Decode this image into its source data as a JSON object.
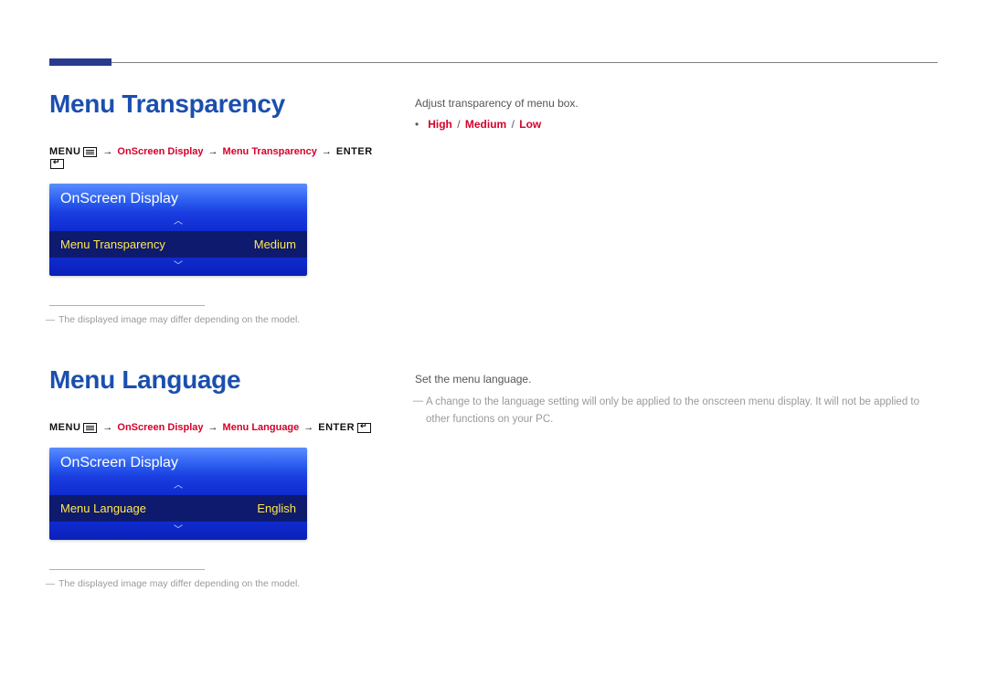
{
  "section1": {
    "heading": "Menu Transparency",
    "breadcrumb": {
      "menu": "MENU",
      "part1": "OnScreen Display",
      "part2": "Menu Transparency",
      "enter": "ENTER"
    },
    "osd": {
      "title": "OnScreen Display",
      "item_label": "Menu Transparency",
      "item_value": "Medium"
    },
    "footnote": "The displayed image may differ depending on the model.",
    "right": {
      "intro": "Adjust transparency of menu box.",
      "options": [
        "High",
        "Medium",
        "Low"
      ]
    }
  },
  "section2": {
    "heading": "Menu Language",
    "breadcrumb": {
      "menu": "MENU",
      "part1": "OnScreen Display",
      "part2": "Menu Language",
      "enter": "ENTER"
    },
    "osd": {
      "title": "OnScreen Display",
      "item_label": "Menu Language",
      "item_value": "English"
    },
    "footnote": "The displayed image may differ depending on the model.",
    "right": {
      "intro": "Set the menu language.",
      "note": "A change to the language setting will only be applied to the onscreen menu display. It will not be applied to other functions on your PC."
    }
  }
}
